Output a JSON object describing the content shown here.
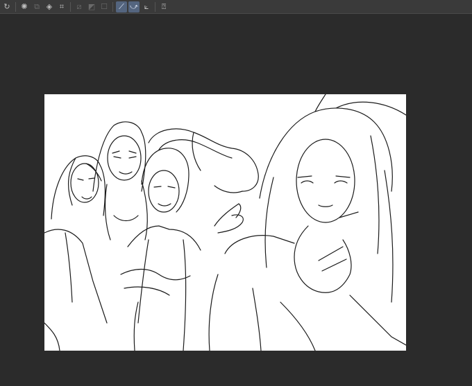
{
  "toolbar": {
    "buttons": [
      {
        "icon": "redo-icon",
        "glyph": "↻",
        "state": "dim"
      },
      {
        "icon": "loading-spinner-icon",
        "glyph": "✺",
        "state": "normal"
      },
      {
        "icon": "layer-copy-icon",
        "glyph": "⧉",
        "state": "dim"
      },
      {
        "icon": "fill-bucket-icon",
        "glyph": "◈",
        "state": "normal"
      },
      {
        "icon": "transform-icon",
        "glyph": "⌗",
        "state": "normal"
      },
      {
        "icon": "pen-slash-icon",
        "glyph": "⧄",
        "state": "dim"
      },
      {
        "icon": "tone-icon",
        "glyph": "◩",
        "state": "dim"
      },
      {
        "icon": "frame-icon",
        "glyph": "☐",
        "state": "dim"
      },
      {
        "icon": "ruler-line-icon",
        "glyph": "⟋",
        "state": "active"
      },
      {
        "icon": "ruler-curve-icon",
        "glyph": "⤻",
        "state": "active"
      },
      {
        "icon": "snap-ruler-icon",
        "glyph": "⟀",
        "state": "normal"
      },
      {
        "icon": "help-icon",
        "glyph": "⍰",
        "state": "normal"
      }
    ]
  },
  "colors": {
    "workspace": "#2b2b2b",
    "toolbar": "#3a3a3a",
    "active_toggle": "#54657f",
    "paper": "#ffffff",
    "ink": "#1a1a1a"
  }
}
